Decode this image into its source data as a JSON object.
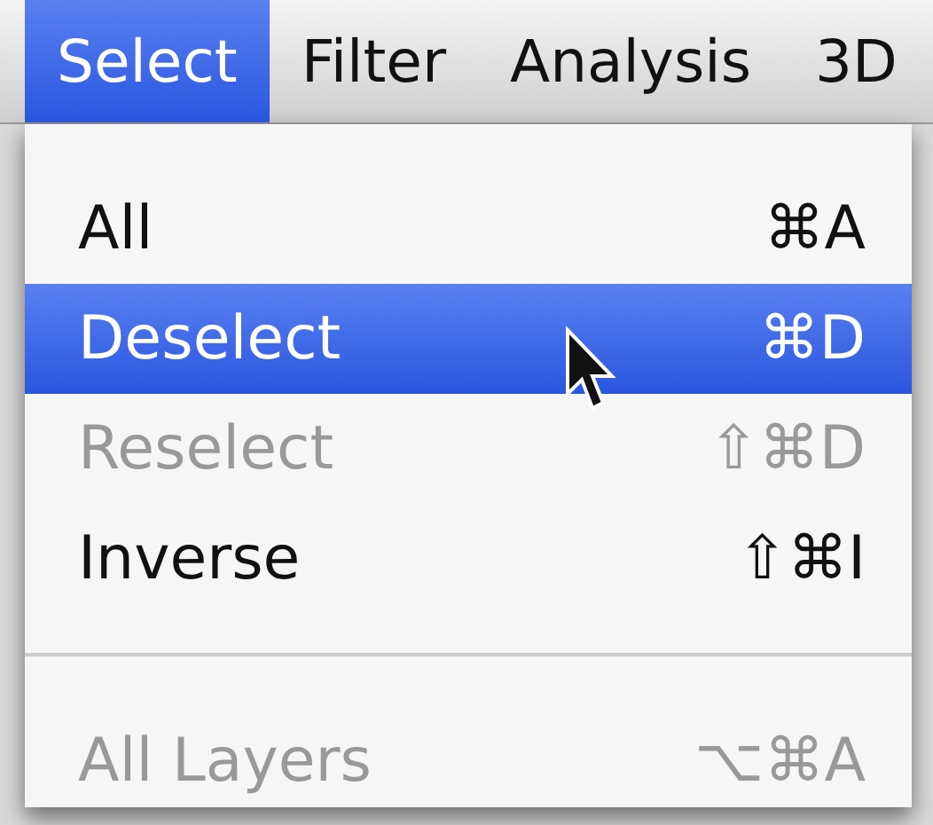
{
  "menu_bar": [
    {
      "label": "Select",
      "selected": true
    },
    {
      "label": "Filter",
      "selected": false
    },
    {
      "label": "Analysis",
      "selected": false
    },
    {
      "label": "3D",
      "selected": false
    }
  ],
  "menu": [
    {
      "kind": "item",
      "label": "All",
      "shortcut": "⌘A",
      "highlighted": false,
      "disabled": false
    },
    {
      "kind": "item",
      "label": "Deselect",
      "shortcut": "⌘D",
      "highlighted": true,
      "disabled": false
    },
    {
      "kind": "item",
      "label": "Reselect",
      "shortcut": "⇧⌘D",
      "highlighted": false,
      "disabled": true
    },
    {
      "kind": "item",
      "label": "Inverse",
      "shortcut": "⇧⌘I",
      "highlighted": false,
      "disabled": false
    },
    {
      "kind": "separator"
    },
    {
      "kind": "item",
      "label": "All Layers",
      "shortcut": "⌥⌘A",
      "highlighted": false,
      "disabled": true
    }
  ]
}
